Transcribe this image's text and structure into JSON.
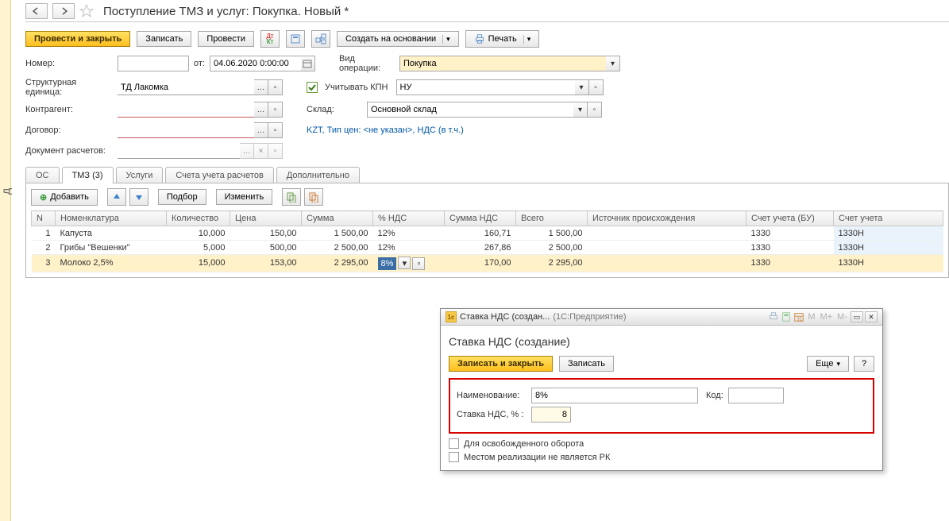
{
  "left_tab_text": "д",
  "title": "Поступление ТМЗ и услуг: Покупка. Новый *",
  "toolbar": {
    "post_close": "Провести и закрыть",
    "save": "Записать",
    "post": "Провести",
    "create_based": "Создать на основании",
    "print": "Печать"
  },
  "form": {
    "number_lbl": "Номер:",
    "from_lbl": "от:",
    "date_value": "04.06.2020 0:00:00",
    "op_type_lbl": "Вид операции:",
    "op_type_val": "Покупка",
    "unit_lbl": "Структурная единица:",
    "unit_val": "ТД Лакомка",
    "kpn_lbl": "Учитывать КПН",
    "kpn_val": "НУ",
    "counterparty_lbl": "Контрагент:",
    "warehouse_lbl": "Склад:",
    "warehouse_val": "Основной склад",
    "contract_lbl": "Договор:",
    "price_note": "KZT, Тип цен: <не указан>, НДС (в т.ч.)",
    "settlement_lbl": "Документ расчетов:"
  },
  "tabs": {
    "os": "ОС",
    "tmz": "ТМЗ (3)",
    "services": "Услуги",
    "accounts": "Счета учета расчетов",
    "additional": "Дополнительно"
  },
  "rowtools": {
    "add": "Добавить",
    "select": "Подбор",
    "change": "Изменить"
  },
  "columns": {
    "n": "N",
    "nomen": "Номенклатура",
    "qty": "Количество",
    "price": "Цена",
    "sum": "Сумма",
    "vat_pct": "% НДС",
    "vat_sum": "Сумма НДС",
    "total": "Всего",
    "origin": "Источник происхождения",
    "acct_bu": "Счет учета (БУ)",
    "acct_nu": "Счет учета"
  },
  "rows": [
    {
      "n": "1",
      "nomen": "Капуста",
      "qty": "10,000",
      "price": "150,00",
      "sum": "1 500,00",
      "vat_pct": "12%",
      "vat_sum": "160,71",
      "total": "1 500,00",
      "origin": "",
      "acct_bu": "1330",
      "acct_nu": "1330Н"
    },
    {
      "n": "2",
      "nomen": "Грибы \"Вешенки\"",
      "qty": "5,000",
      "price": "500,00",
      "sum": "2 500,00",
      "vat_pct": "12%",
      "vat_sum": "267,86",
      "total": "2 500,00",
      "origin": "",
      "acct_bu": "1330",
      "acct_nu": "1330Н"
    },
    {
      "n": "3",
      "nomen": "Молоко 2,5%",
      "qty": "15,000",
      "price": "153,00",
      "sum": "2 295,00",
      "vat_pct": "8%",
      "vat_sum": "170,00",
      "total": "2 295,00",
      "origin": "",
      "acct_bu": "1330",
      "acct_nu": "1330Н"
    }
  ],
  "dialog": {
    "win_title_short": "Ставка НДС (создан...",
    "win_title_app": "(1С:Предприятие)",
    "faded1": "М",
    "faded2": "М+",
    "faded3": "М-",
    "heading": "Ставка НДС (создание)",
    "save_close": "Записать и закрыть",
    "save": "Записать",
    "more": "Еще",
    "help": "?",
    "name_lbl": "Наименование:",
    "name_val": "8%",
    "code_lbl": "Код:",
    "rate_lbl": "Ставка НДС, % :",
    "rate_val": "8",
    "chk1": "Для освобожденного оборота",
    "chk2": "Местом реализации не является РК"
  }
}
